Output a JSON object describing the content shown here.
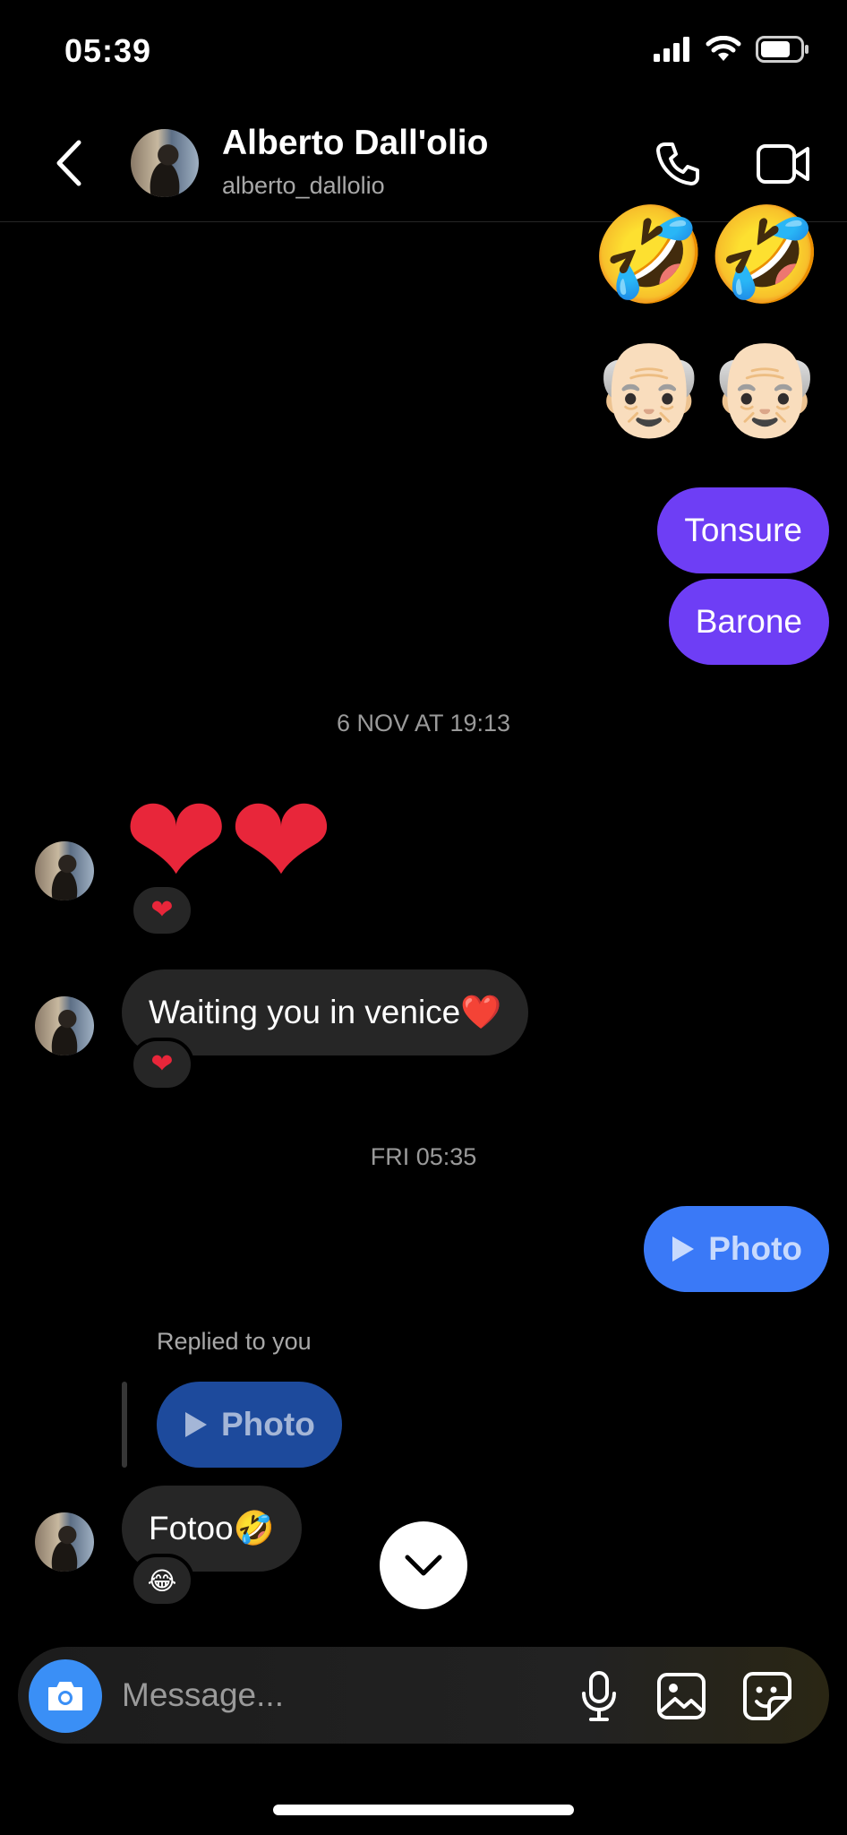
{
  "status_bar": {
    "time": "05:39",
    "icons": [
      "cellular-signal-icon",
      "wifi-icon",
      "battery-icon"
    ]
  },
  "header": {
    "contact_name": "Alberto Dall'olio",
    "username": "alberto_dallolio",
    "icons": [
      "back-icon",
      "phone-icon",
      "video-icon"
    ]
  },
  "messages": {
    "sent_emoji_1": "🤣🤣",
    "sent_emoji_2": "👴🏻👴🏻",
    "sent_text_1": "Tonsure",
    "sent_text_2": "Barone",
    "timestamp_1": "6 NOV AT 19:13",
    "received_hearts": "❤❤",
    "reaction_1": "❤",
    "received_text_1": "Waiting you in venice❤️",
    "reaction_2": "❤",
    "timestamp_2": "FRI 05:35",
    "sent_photo_label": "Photo",
    "replied_label": "Replied to you",
    "replied_photo_label": "Photo",
    "received_text_2": "Fotoo🤣",
    "reaction_3": "😂"
  },
  "composer": {
    "placeholder": "Message...",
    "icons": [
      "camera-icon",
      "microphone-icon",
      "gallery-icon",
      "sticker-icon"
    ]
  },
  "colors": {
    "sent_bubble": "#6e3ef5",
    "photo_bubble": "#3a79f7",
    "received_bubble": "#262626",
    "camera_button": "#3a8ff6"
  }
}
